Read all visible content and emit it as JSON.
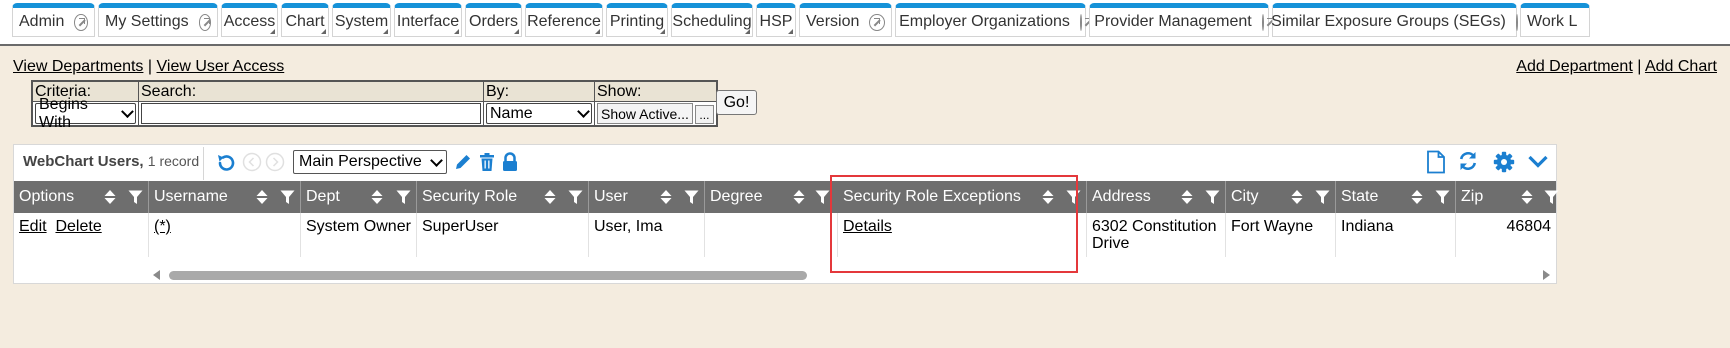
{
  "nav_tabs": [
    {
      "label": "Admin",
      "ext": true
    },
    {
      "label": "My Settings",
      "ext": true
    },
    {
      "label": "Access",
      "ext": false
    },
    {
      "label": "Chart",
      "ext": false
    },
    {
      "label": "System",
      "ext": false
    },
    {
      "label": "Interface",
      "ext": false
    },
    {
      "label": "Orders",
      "ext": false
    },
    {
      "label": "Reference",
      "ext": false
    },
    {
      "label": "Printing",
      "ext": false
    },
    {
      "label": "Scheduling",
      "ext": false
    },
    {
      "label": "HSP",
      "ext": false
    },
    {
      "label": "Version",
      "ext": true
    },
    {
      "label": "Employer Organizations",
      "ext": true
    },
    {
      "label": "Provider Management",
      "ext": true
    },
    {
      "label": "Similar Exposure Groups (SEGs)",
      "ext": true
    },
    {
      "label": "Work L",
      "ext": false
    }
  ],
  "links": {
    "view_departments": "View Departments",
    "view_user_access": "View User Access",
    "separator": "|",
    "add_department": "Add Department",
    "add_chart": "Add Chart"
  },
  "filter": {
    "criteria_label": "Criteria:",
    "search_label": "Search:",
    "by_label": "By:",
    "show_label": "Show:",
    "criteria_value": "Begins With",
    "search_value": "",
    "by_value": "Name",
    "show_value": "Show Active...",
    "show_more": "...",
    "go_label": "Go!"
  },
  "grid": {
    "title": "WebChart Users,",
    "record_count": "1 record",
    "perspective": "Main Perspective",
    "columns": [
      "Options",
      "Username",
      "Dept",
      "Security Role",
      "User",
      "Degree",
      "Security Role Exceptions",
      "Address",
      "City",
      "State",
      "Zip"
    ],
    "row": {
      "edit": "Edit",
      "delete": "Delete",
      "username": "(*)",
      "dept": "System Owner",
      "security_role": "SuperUser",
      "user": "User, Ima",
      "degree": "",
      "exceptions": "Details",
      "address": "6302 Constitution Drive",
      "city": "Fort Wayne",
      "state": "Indiana",
      "zip": "46804"
    }
  },
  "colors": {
    "accent": "#1592d8",
    "header_bg": "#6e6e6e",
    "highlight": "#e4383b",
    "page_bg": "#f4ecdf"
  }
}
